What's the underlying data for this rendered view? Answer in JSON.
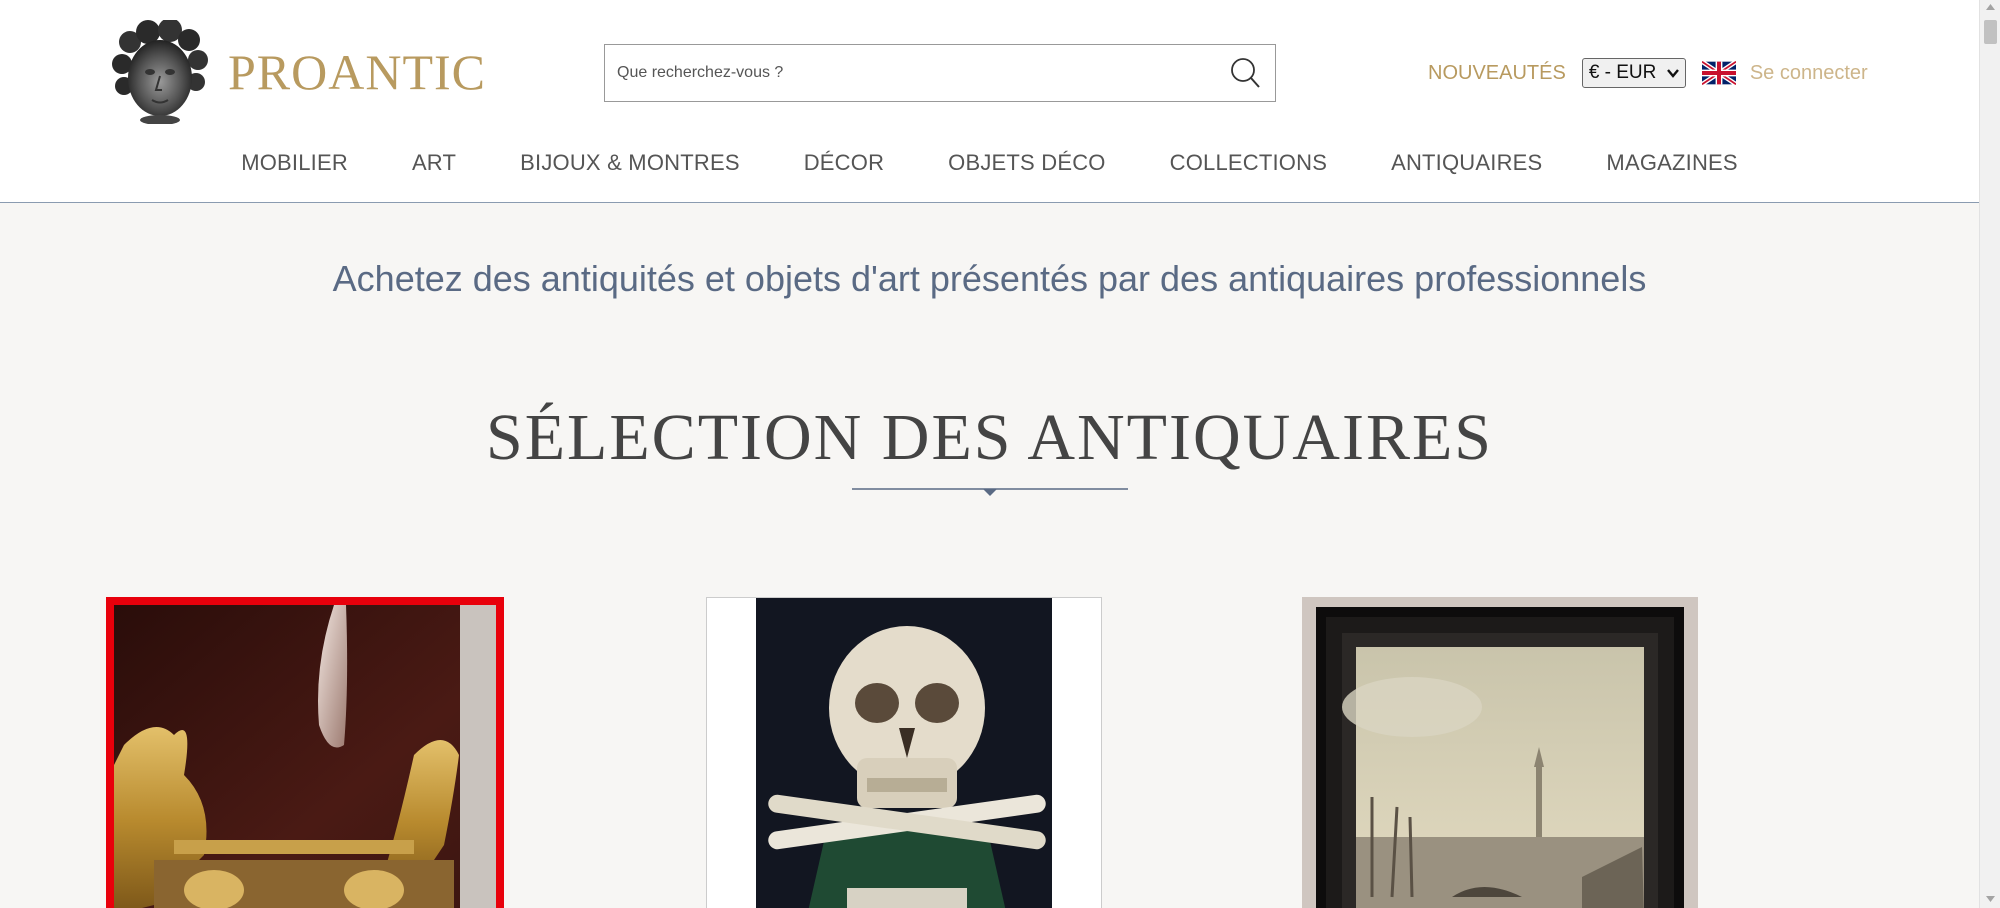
{
  "header": {
    "brand": "PROANTIC",
    "search": {
      "placeholder": "Que recherchez-vous ?",
      "value": ""
    },
    "nouveautes": "NOUVEAUTÉS",
    "currency": "€ - EUR",
    "login": "Se connecter"
  },
  "nav": {
    "items": [
      {
        "label": "MOBILIER"
      },
      {
        "label": "ART"
      },
      {
        "label": "BIJOUX & MONTRES"
      },
      {
        "label": "DÉCOR"
      },
      {
        "label": "OBJETS DÉCO"
      },
      {
        "label": "COLLECTIONS"
      },
      {
        "label": "ANTIQUAIRES"
      },
      {
        "label": "MAGAZINES"
      }
    ]
  },
  "main": {
    "tagline": "Achetez des antiquités et objets d'art présentés par des antiquaires professionnels",
    "section_title": "SÉLECTION DES ANTIQUAIRES"
  },
  "icons": {
    "logo": "logo-head-icon",
    "search": "search-icon",
    "flag": "uk-flag-icon",
    "currency_chevron": "chevron-down-icon"
  },
  "colors": {
    "brand_gold": "#b89a5f",
    "login_gold": "#cdb58a",
    "tagline_blue": "#5a6a84",
    "selected_border": "#e8000b",
    "page_bg": "#f7f6f4"
  }
}
